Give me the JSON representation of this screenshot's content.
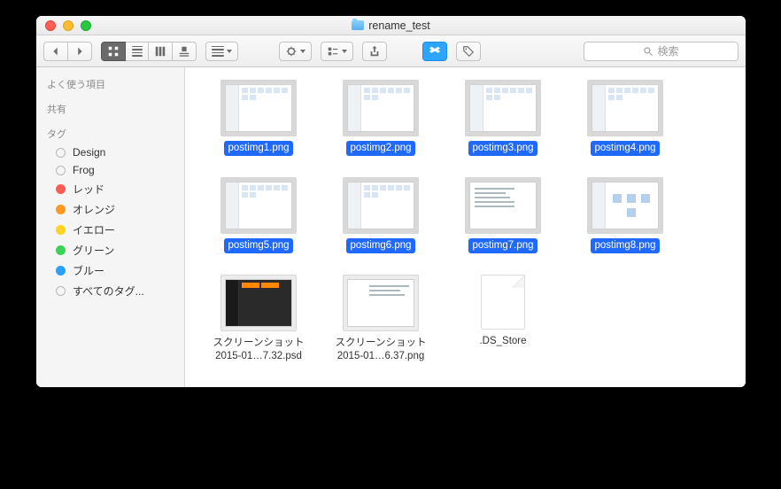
{
  "window": {
    "title": "rename_test"
  },
  "search": {
    "placeholder": "検索"
  },
  "sidebar": {
    "favorites_heading": "よく使う項目",
    "shared_heading": "共有",
    "tags_heading": "タグ",
    "tags": [
      {
        "label": "Design",
        "color": "",
        "solid": false
      },
      {
        "label": "Frog",
        "color": "",
        "solid": false
      },
      {
        "label": "レッド",
        "color": "#ff5b52",
        "solid": true
      },
      {
        "label": "オレンジ",
        "color": "#ff9a1f",
        "solid": true
      },
      {
        "label": "イエロー",
        "color": "#ffd21f",
        "solid": true
      },
      {
        "label": "グリーン",
        "color": "#3dd156",
        "solid": true
      },
      {
        "label": "ブルー",
        "color": "#2aa0ff",
        "solid": true
      },
      {
        "label": "すべてのタグ...",
        "color": "",
        "solid": false
      }
    ]
  },
  "files": [
    {
      "name": "postimg1.png",
      "selected": true,
      "kind": "app"
    },
    {
      "name": "postimg2.png",
      "selected": true,
      "kind": "app"
    },
    {
      "name": "postimg3.png",
      "selected": true,
      "kind": "app"
    },
    {
      "name": "postimg4.png",
      "selected": true,
      "kind": "app"
    },
    {
      "name": "postimg5.png",
      "selected": true,
      "kind": "app"
    },
    {
      "name": "postimg6.png",
      "selected": true,
      "kind": "app"
    },
    {
      "name": "postimg7.png",
      "selected": true,
      "kind": "text"
    },
    {
      "name": "postimg8.png",
      "selected": true,
      "kind": "icons"
    },
    {
      "name": "スクリーンショット\n2015-01…7.32.psd",
      "selected": false,
      "kind": "dark"
    },
    {
      "name": "スクリーンショット\n2015-01…6.37.png",
      "selected": false,
      "kind": "doc"
    },
    {
      "name": ".DS_Store",
      "selected": false,
      "kind": "blank"
    }
  ]
}
